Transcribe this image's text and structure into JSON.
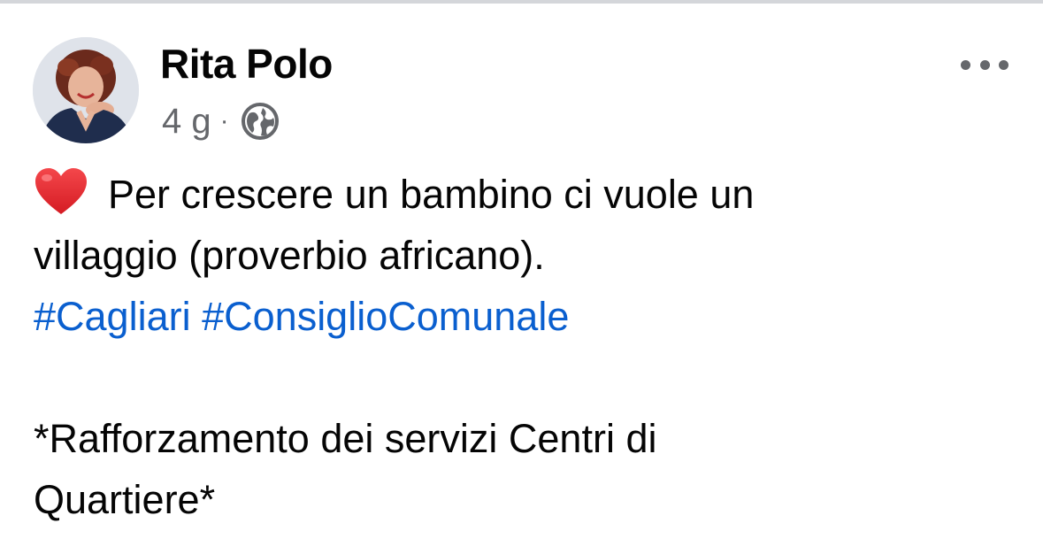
{
  "post": {
    "author": {
      "name": "Rita Polo"
    },
    "meta": {
      "time": "4 g",
      "separator": "·",
      "audience_icon": "globe-icon"
    },
    "more_icon": "more-horizontal-icon",
    "text": {
      "emoji_icon": "red-heart-icon",
      "line1": "Per crescere un bambino ci vuole un",
      "line2": "villaggio (proverbio africano).",
      "hashtags": [
        "#Cagliari",
        "#ConsiglioComunale"
      ],
      "line4": "*Rafforzamento dei servizi Centri di",
      "line5": "Quartiere*"
    }
  },
  "colors": {
    "hashtag": "#0a5fcf",
    "meta_text": "#65676b",
    "heart": "#e0242b",
    "divider": "#d4d6da"
  }
}
